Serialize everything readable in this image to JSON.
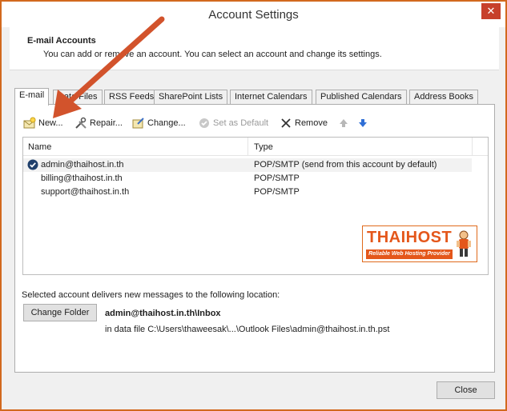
{
  "window": {
    "title": "Account Settings",
    "close_glyph": "✕"
  },
  "header": {
    "title": "E-mail Accounts",
    "description": "You can add or remove an account. You can select an account and change its settings."
  },
  "tabs": [
    "E-mail",
    "Data Files",
    "RSS Feeds",
    "SharePoint Lists",
    "Internet Calendars",
    "Published Calendars",
    "Address Books"
  ],
  "toolbar": {
    "new": "New...",
    "repair": "Repair...",
    "change": "Change...",
    "set_default": "Set as Default",
    "remove": "Remove"
  },
  "list": {
    "columns": {
      "name": "Name",
      "type": "Type"
    },
    "rows": [
      {
        "name": "admin@thaihost.in.th",
        "type": "POP/SMTP (send from this account by default)"
      },
      {
        "name": "billing@thaihost.in.th",
        "type": "POP/SMTP"
      },
      {
        "name": "support@thaihost.in.th",
        "type": "POP/SMTP"
      }
    ]
  },
  "logo": {
    "text": "THAIHOST",
    "tagline": "Reliable Web Hosting Provider"
  },
  "delivery": {
    "label": "Selected account delivers new messages to the following location:",
    "change_folder": "Change Folder",
    "inbox_path": "admin@thaihost.in.th\\Inbox",
    "data_file": "in data file C:\\Users\\thaweesak\\...\\Outlook Files\\admin@thaihost.in.th.pst"
  },
  "footer": {
    "close": "Close"
  },
  "colors": {
    "accent_border": "#d2691e",
    "arrow": "#d2532c",
    "logo": "#e4571b"
  }
}
